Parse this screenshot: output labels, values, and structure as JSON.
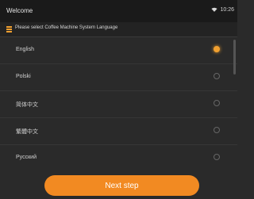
{
  "status_bar": {
    "title": "Welcome",
    "time": "10:26",
    "wifi_icon": "wifi-icon"
  },
  "header": {
    "menu_icon": "menu-icon",
    "text": "Please select Coffee Machine System Language"
  },
  "languages": [
    {
      "label": "English",
      "selected": true
    },
    {
      "label": "Polski",
      "selected": false
    },
    {
      "label": "简体中文",
      "selected": false
    },
    {
      "label": "繁體中文",
      "selected": false
    },
    {
      "label": "Русский",
      "selected": false
    }
  ],
  "action": {
    "next_label": "Next step"
  },
  "colors": {
    "accent": "#f28a22",
    "background": "#2a2a2a"
  }
}
